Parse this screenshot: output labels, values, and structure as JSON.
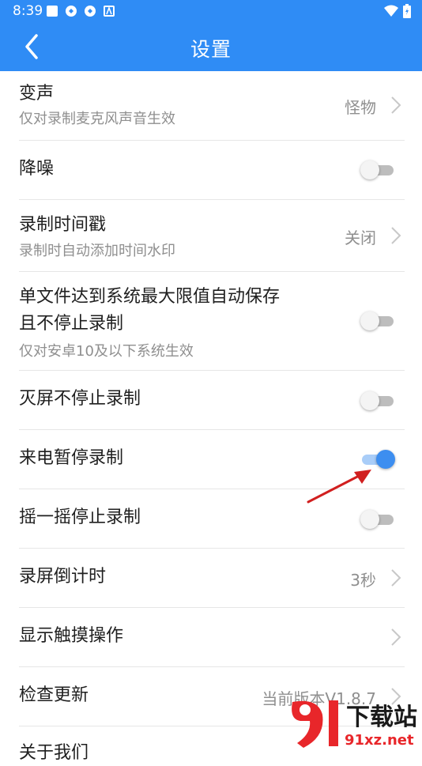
{
  "status_bar": {
    "time": "8:39"
  },
  "app_bar": {
    "title": "设置"
  },
  "settings": [
    {
      "label": "变声",
      "sub": "仅对录制麦克风声音生效",
      "value": "怪物"
    },
    {
      "label": "降噪"
    },
    {
      "label": "录制时间戳",
      "sub": "录制时自动添加时间水印",
      "value": "关闭"
    },
    {
      "label_line1": "单文件达到系统最大限值自动保存",
      "label_line2": "且不停止录制",
      "sub": "仅对安卓10及以下系统生效"
    },
    {
      "label": "灭屏不停止录制"
    },
    {
      "label": "来电暂停录制"
    },
    {
      "label": "摇一摇停止录制"
    },
    {
      "label": "录屏倒计时",
      "value": "3秒"
    },
    {
      "label": "显示触摸操作"
    },
    {
      "label": "检查更新",
      "value": "当前版本V1.8.7"
    },
    {
      "label": "关于我们"
    }
  ],
  "toggles": {
    "noise_reduction": false,
    "screen_off_continue": false,
    "pause_on_call": true,
    "shake_stop": false
  },
  "watermark": {
    "brand_text": "下载站",
    "domain": "91xz.net"
  },
  "colors": {
    "accent": "#2f8cf5",
    "toggle_on": "#3d8ef0",
    "arrow": "#d11f1f"
  },
  "icons": [
    "status-app-icon",
    "wifi-icon",
    "battery-icon",
    "back-arrow-icon",
    "chevron-right-icon"
  ]
}
